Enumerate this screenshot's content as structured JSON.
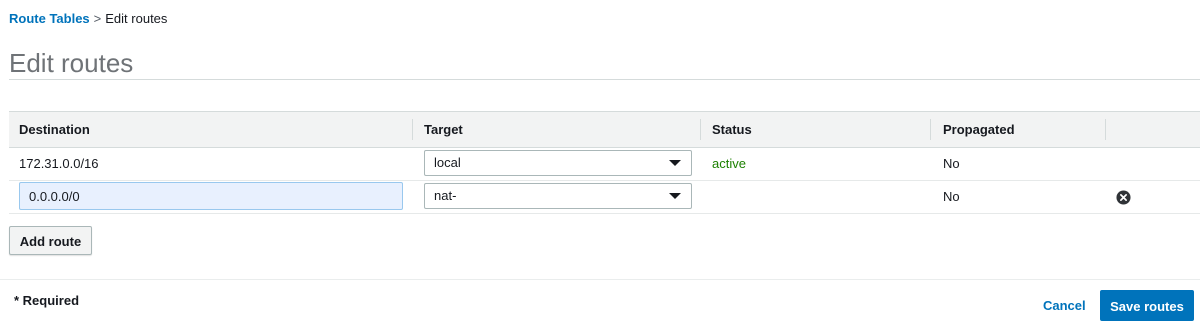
{
  "breadcrumb": {
    "parent": "Route Tables",
    "separator": ">",
    "current": "Edit routes"
  },
  "page_title": "Edit routes",
  "table": {
    "columns": [
      "Destination",
      "Target",
      "Status",
      "Propagated"
    ],
    "rows": [
      {
        "destination": "172.31.0.0/16",
        "target": "local",
        "status": "active",
        "propagated": "No",
        "editable": false
      },
      {
        "destination": "0.0.0.0/0",
        "target": "nat-",
        "status": "",
        "propagated": "No",
        "editable": true,
        "remove_icon": "close-circle-icon"
      }
    ]
  },
  "add_route_label": "Add route",
  "footer": {
    "required_note": "* Required",
    "cancel_label": "Cancel",
    "save_label": "Save routes"
  },
  "colors": {
    "link": "#0073bb",
    "primary_button": "#0073bb",
    "status_active": "#1d8102",
    "header_bg": "#f2f3f3"
  }
}
